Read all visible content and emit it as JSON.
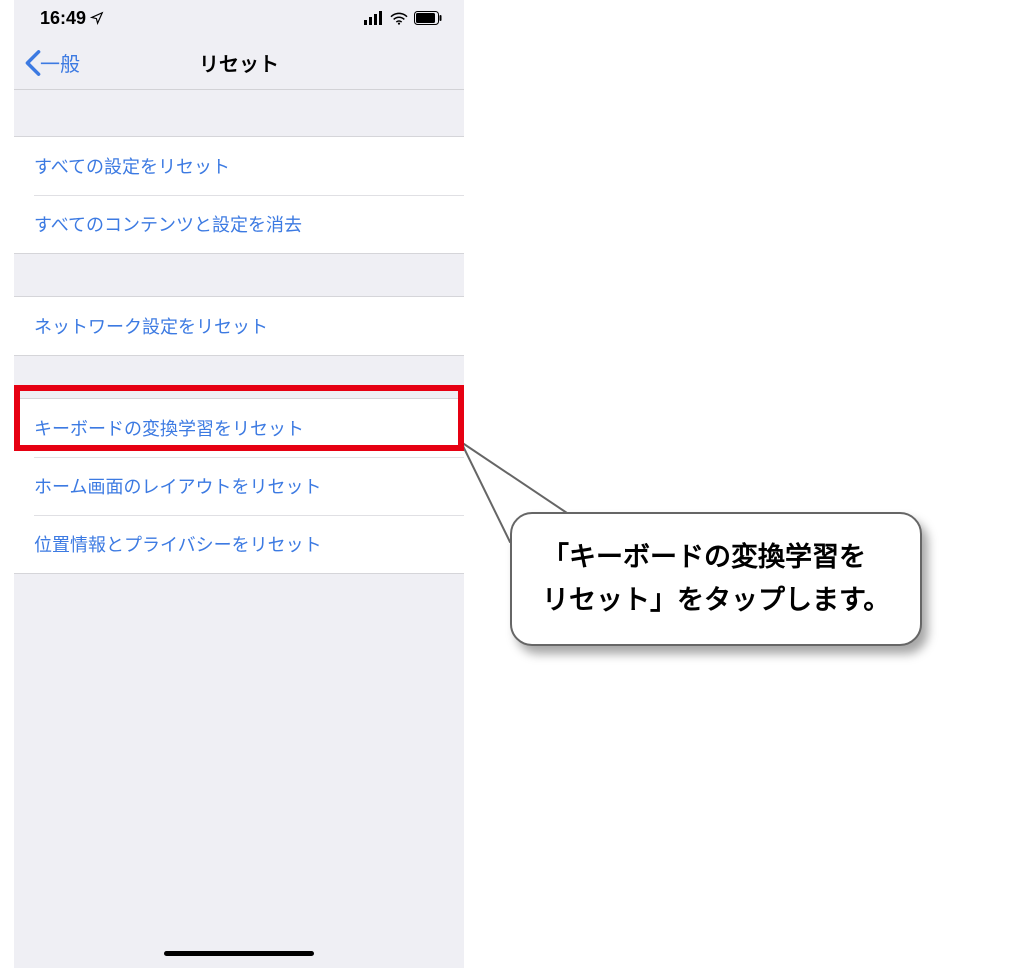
{
  "status": {
    "time": "16:49",
    "location_icon": "location-arrow",
    "signal_icon": "cellular-signal",
    "wifi_icon": "wifi",
    "battery_icon": "battery"
  },
  "nav": {
    "back_label": "一般",
    "title": "リセット"
  },
  "group1": {
    "items": [
      {
        "label": "すべての設定をリセット"
      },
      {
        "label": "すべてのコンテンツと設定を消去"
      }
    ]
  },
  "group2": {
    "items": [
      {
        "label": "ネットワーク設定をリセット"
      }
    ]
  },
  "group3": {
    "items": [
      {
        "label": "キーボードの変換学習をリセット"
      },
      {
        "label": "ホーム画面のレイアウトをリセット"
      },
      {
        "label": "位置情報とプライバシーをリセット"
      }
    ]
  },
  "callout": {
    "line1": "「キーボードの変換学習を",
    "line2": "リセット」をタップします。"
  },
  "highlight": {
    "color": "#e60012"
  }
}
